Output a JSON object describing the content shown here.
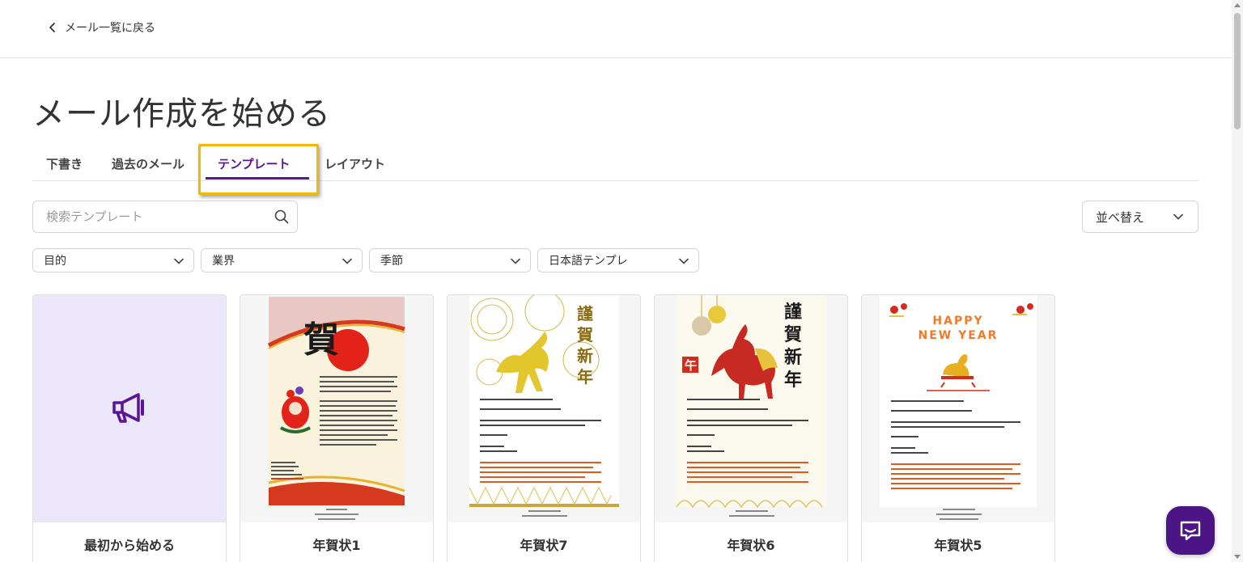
{
  "nav": {
    "back_label": "メール一覧に戻る"
  },
  "page": {
    "title": "メール作成を始める"
  },
  "tabs": [
    {
      "label": "下書き"
    },
    {
      "label": "過去のメール"
    },
    {
      "label": "テンプレート",
      "active": true
    },
    {
      "label": "レイアウト"
    }
  ],
  "search": {
    "placeholder": "検索テンプレート",
    "value": ""
  },
  "sort": {
    "label": "並べ替え"
  },
  "filters": [
    {
      "label": "目的"
    },
    {
      "label": "業界"
    },
    {
      "label": "季節"
    },
    {
      "label": "日本語テンプレ"
    }
  ],
  "templates": [
    {
      "label": "最初から始める",
      "icon": "megaphone-icon"
    },
    {
      "label": "年賀状1",
      "headline": "賀"
    },
    {
      "label": "年賀状7",
      "headline": "謹賀新年"
    },
    {
      "label": "年賀状6",
      "headline": "謹賀新年"
    },
    {
      "label": "年賀状5",
      "headline": "HAPPY NEW YEAR"
    }
  ],
  "colors": {
    "accent": "#5a1496",
    "highlight": "#f5b800",
    "chat": "#4b1585",
    "blank_card": "#ebe6fa"
  }
}
